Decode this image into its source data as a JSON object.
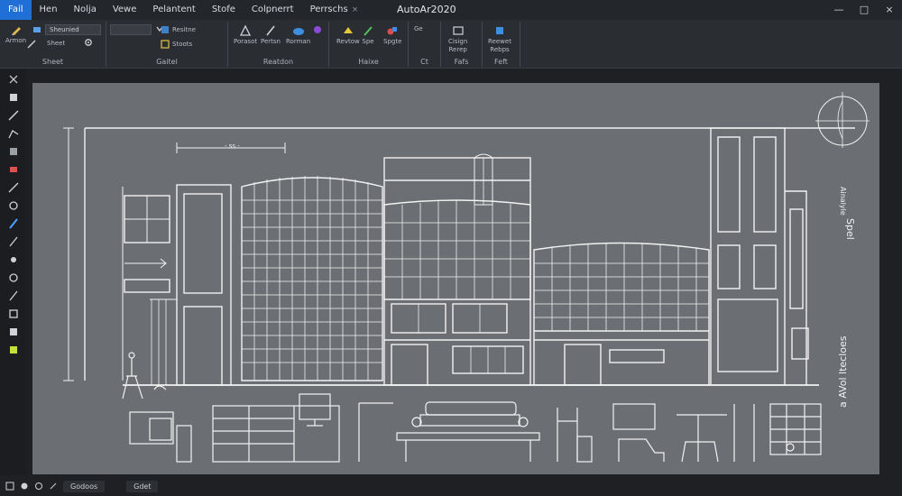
{
  "app": {
    "title": "AutoAr2020"
  },
  "menu": {
    "items": [
      "Fail",
      "Hen",
      "Nolja",
      "Vewe",
      "Pelantent",
      "Stofe",
      "Colpnerrt",
      "Perrschs"
    ],
    "close_glyph": "×"
  },
  "window_controls": {
    "minimize": "—",
    "maximize": "□",
    "close": "×"
  },
  "ribbon": {
    "groups": [
      {
        "title": "Sheet",
        "buttons": [
          "Armon",
          "Sheet",
          "Sheet"
        ],
        "dropdown": "Sheunied"
      },
      {
        "title": "Gaitel",
        "dropdown": "",
        "small_labels": [
          "Resitne",
          "Stoots"
        ]
      },
      {
        "title": "Reatdon",
        "buttons": [
          "Porasot",
          "Pertsn",
          "Rorman"
        ]
      },
      {
        "title": "Haixe",
        "buttons": [
          "Revtow",
          "Spe",
          "Spgte"
        ]
      },
      {
        "title": "Ct",
        "buttons": [
          "Ge"
        ]
      },
      {
        "title": "Fafs",
        "buttons": [
          "Cisign",
          "Rerep"
        ]
      },
      {
        "title": "Feft",
        "buttons": [
          "Reewet",
          "Rebps"
        ]
      }
    ]
  },
  "colors": {
    "menu_active": "#1f6fd6",
    "canvas_bg": "#6b6e72",
    "line": "#f2f2f2",
    "ribbon_bg": "#2a2d32"
  },
  "drawing": {
    "side_label_1": "Ainalyle",
    "side_label_2": "Spel",
    "side_label_3": "a AVol ltecloes",
    "top_dim_label": "- ss -"
  },
  "statusbar": {
    "tabs": [
      "Godoos",
      "Gdet"
    ]
  }
}
